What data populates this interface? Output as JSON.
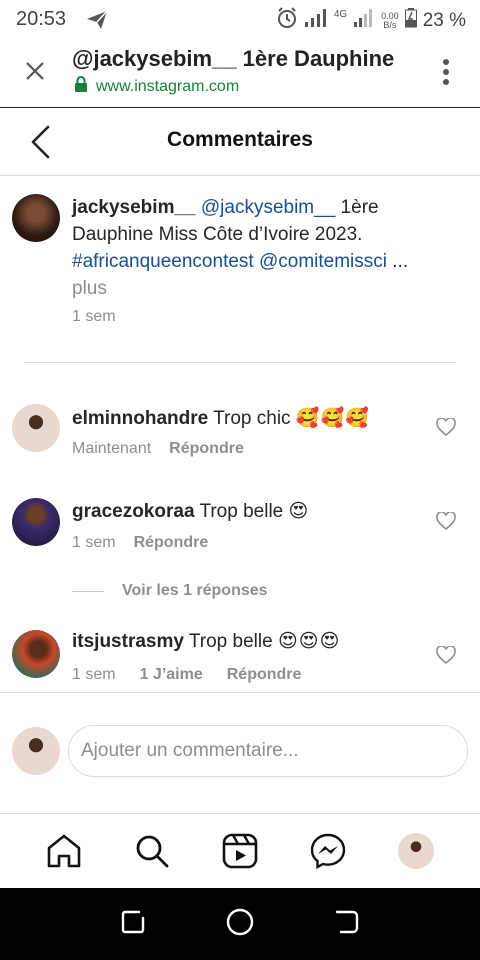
{
  "status_bar": {
    "time": "20:53",
    "network": "4G",
    "speed_value": "0.00",
    "speed_unit": "B/s",
    "battery": "23 %"
  },
  "browser": {
    "title": "@jackysebim__ 1ère Dauphine",
    "url": "www.instagram.com",
    "icons": [
      "close-icon",
      "lock-icon",
      "more-vert-icon"
    ]
  },
  "header": {
    "title": "Commentaires"
  },
  "caption": {
    "username": "jackysebim__",
    "mention1": "@jackysebim__",
    "text1": " 1ère Dauphine Miss Côte d’Ivoire 2023.",
    "hashtag": "#africanqueencontest",
    "mention2": "@comitemissci",
    "ellipsis": " ...",
    "more": "plus",
    "time": "1 sem"
  },
  "comments": [
    {
      "username": "elminnohandre",
      "text": "Trop chic",
      "emoji": "🥰🥰🥰",
      "time": "Maintenant",
      "likes": "",
      "reply": "Répondre"
    },
    {
      "username": "gracezokoraa",
      "text": "Trop belle",
      "emoji": "😍",
      "time": "1 sem",
      "likes": "",
      "reply": "Répondre"
    },
    {
      "username": "itsjustrasmy",
      "text": "Trop belle",
      "emoji": "😍😍😍",
      "time": "1 sem",
      "likes": "1 J’aime",
      "reply": "Répondre"
    }
  ],
  "view_replies": "Voir les 1 réponses",
  "input": {
    "placeholder": "Ajouter un commentaire..."
  },
  "colors": {
    "link": "#1a4f8a",
    "secure_green": "#188038",
    "muted": "#8e8e8e"
  }
}
